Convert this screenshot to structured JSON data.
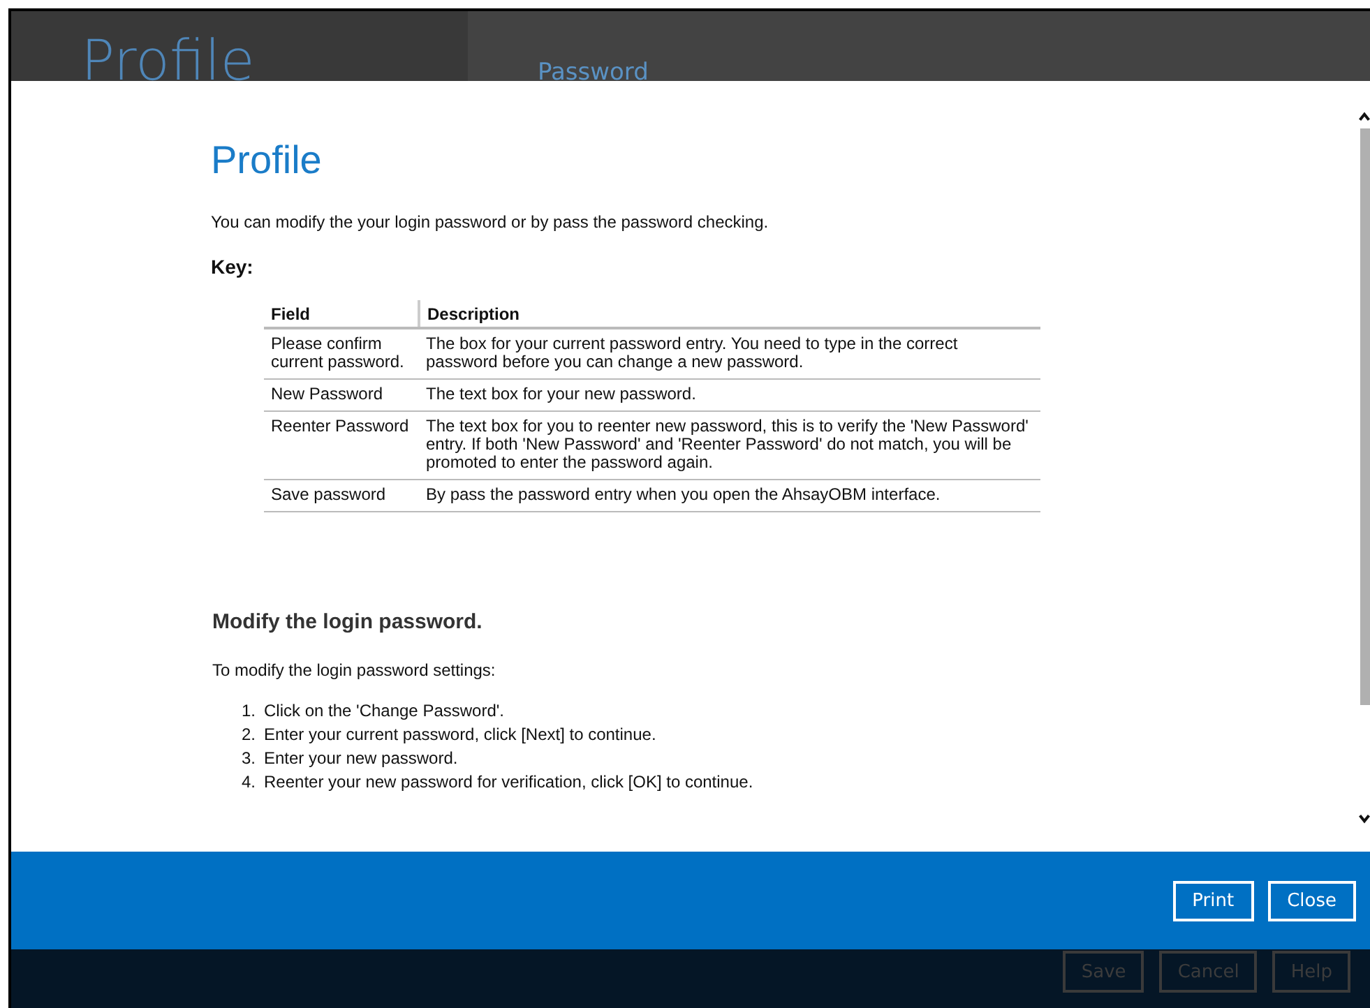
{
  "background": {
    "title": "Profile",
    "tab": "Password"
  },
  "dialog": {
    "title": "Profile",
    "intro": "You can modify the your login password or by pass the password checking.",
    "key_heading": "Key:",
    "table": {
      "columns": [
        "Field",
        "Description"
      ],
      "rows": [
        [
          "Please confirm current password.",
          "The box for your current password entry. You need to type in the correct password before you can change a new password."
        ],
        [
          "New Password",
          "The text box for your new password."
        ],
        [
          "Reenter Password",
          "The text box for you to reenter new password, this is to verify the 'New Password' entry. If both 'New Password' and 'Reenter Password' do not match, you will be promoted to enter the password again."
        ],
        [
          "Save password",
          "By pass the password entry when you open the AhsayOBM interface."
        ]
      ]
    },
    "section_heading": "Modify the login password.",
    "section_intro": "To modify the login password settings:",
    "steps": [
      {
        "number": "1.",
        "text": "Click on the 'Change Password'."
      },
      {
        "number": "2.",
        "text": "Enter your current password, click [Next] to continue."
      },
      {
        "number": "3.",
        "text": "Enter your new password."
      },
      {
        "number": "4.",
        "text": "Reenter your new password for verification, click [OK] to continue."
      }
    ],
    "buttons": [
      "Print",
      "Close"
    ]
  },
  "footer_buttons": [
    {
      "label": "Save",
      "disabled": true
    },
    {
      "label": "Cancel",
      "disabled": true
    },
    {
      "label": "Help",
      "disabled": true
    }
  ]
}
